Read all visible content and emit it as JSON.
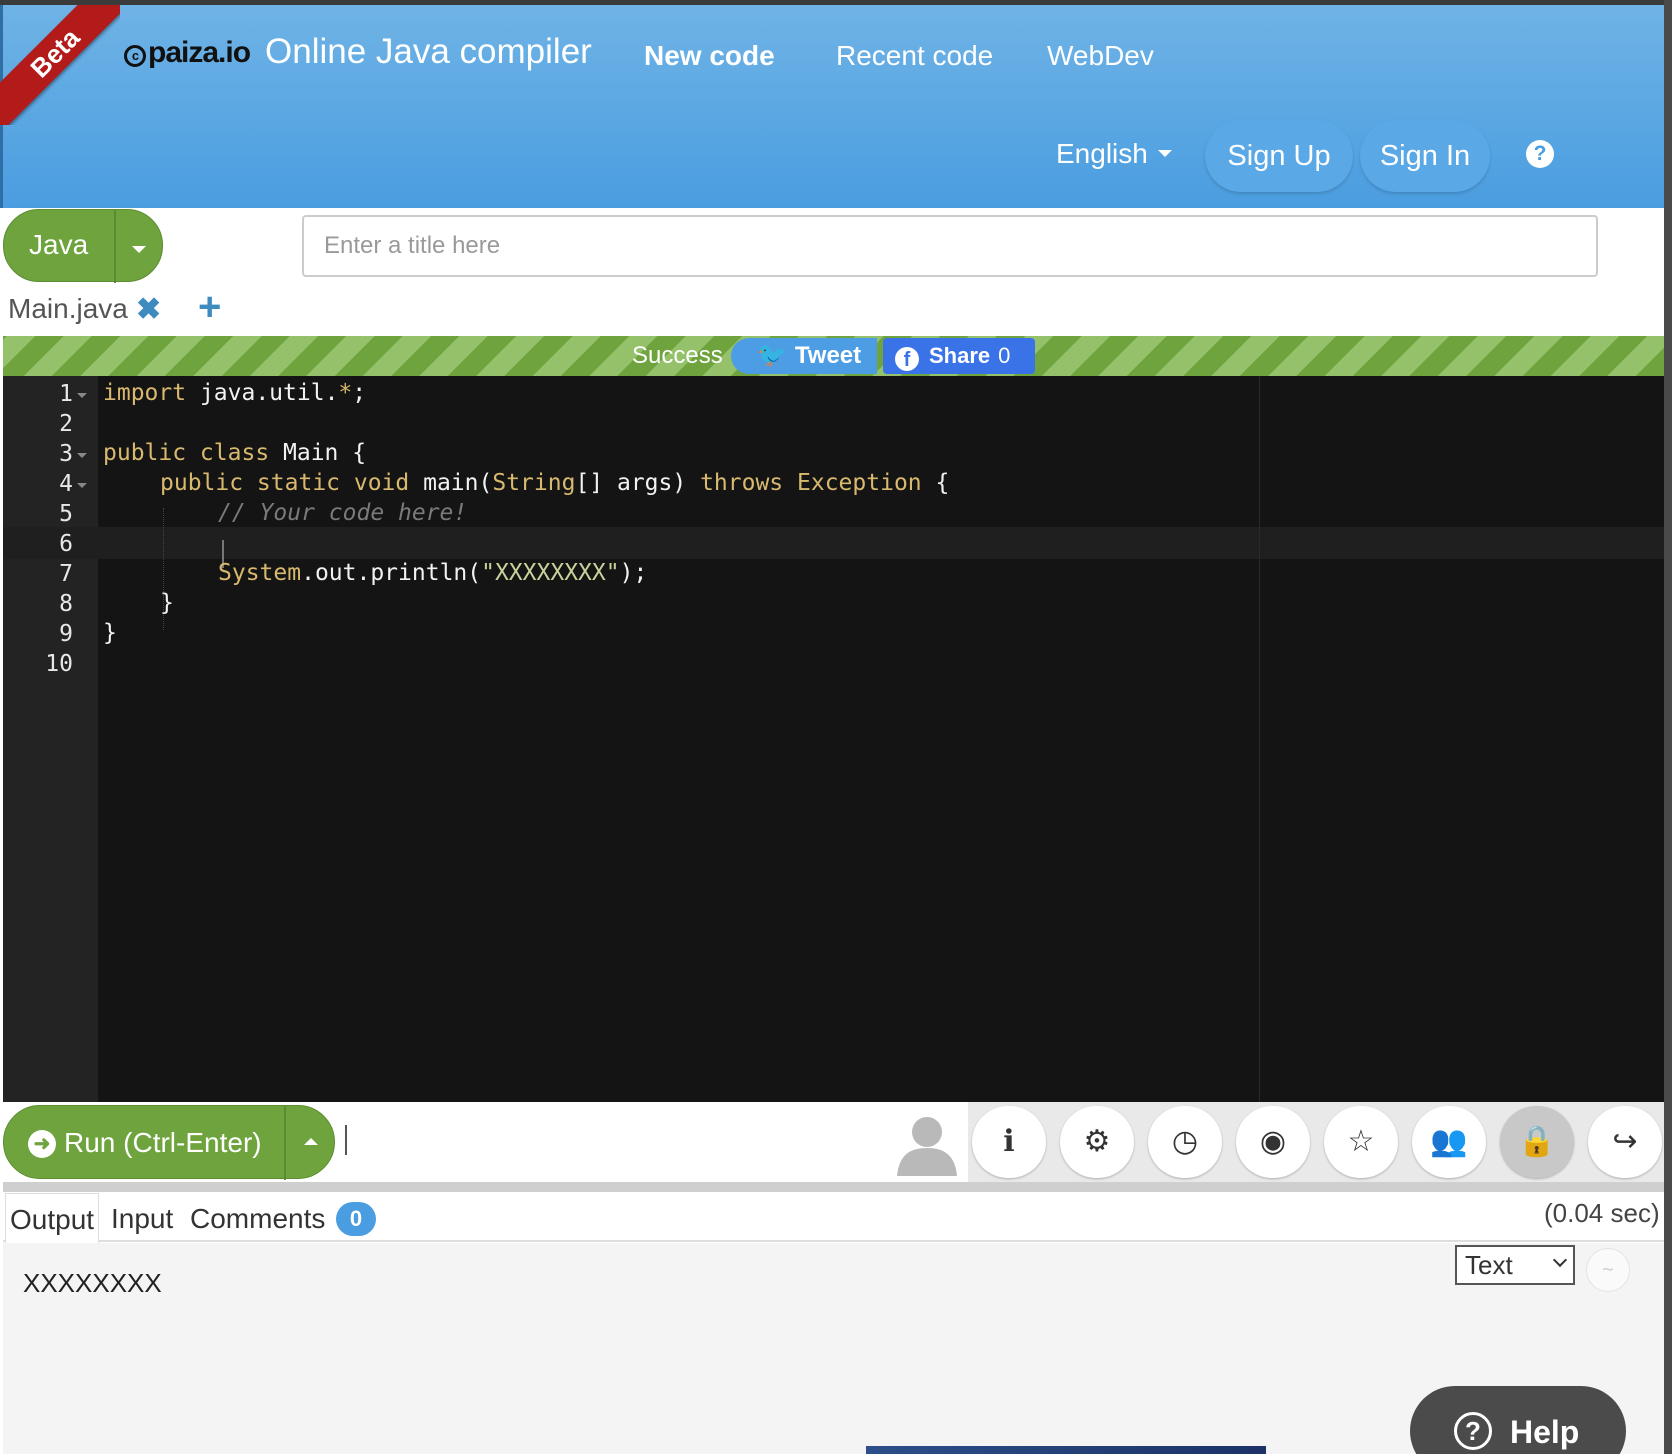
{
  "header": {
    "beta": "Beta",
    "logo": "paiza.io",
    "title": "Online Java compiler",
    "nav": [
      "New code",
      "Recent code",
      "WebDev"
    ],
    "language": "English",
    "sign_up": "Sign Up",
    "sign_in": "Sign In",
    "help_icon": "?"
  },
  "toolbar": {
    "language_button": "Java",
    "title_placeholder": "Enter a title here"
  },
  "files": {
    "active_tab": "Main.java",
    "close_icon": "✖",
    "add_icon": "+"
  },
  "status": {
    "text": "Success",
    "tweet": "Tweet",
    "share": "Share",
    "share_count": "0"
  },
  "editor": {
    "line_numbers": [
      "1",
      "2",
      "3",
      "4",
      "5",
      "6",
      "7",
      "8",
      "9",
      "10"
    ],
    "lines": [
      {
        "kw": "import",
        "rest": " java.util.",
        "op": "*",
        "end": ";"
      },
      {},
      {
        "kw": "public class",
        "rest": " Main {"
      },
      {
        "kw1": "public static void",
        "mid": " main(",
        "ty": "String",
        "mid2": "[] args) ",
        "kw2": "throws",
        "sp": " ",
        "ty2": "Exception",
        "end": " {"
      },
      {
        "comment": "// Your code here!"
      },
      {},
      {
        "ty": "System",
        "rest": ".out.println(",
        "str": "\"XXXXXXXX\"",
        "end": ");"
      },
      {
        "text": "}"
      },
      {
        "text": "}"
      },
      {}
    ]
  },
  "run": {
    "label": "Run (Ctrl-Enter)"
  },
  "tools": {
    "icons": [
      "info-icon",
      "gear-icon",
      "clock-icon",
      "github-icon",
      "star-icon",
      "group-icon",
      "lock-icon",
      "share-icon"
    ],
    "glyphs": [
      "ℹ",
      "⚙",
      "◷",
      "◉",
      "☆",
      "👥",
      "🔒",
      "↪"
    ]
  },
  "output": {
    "tabs": [
      "Output",
      "Input",
      "Comments"
    ],
    "comments_count": "0",
    "runtime": "(0.04 sec)",
    "text": "XXXXXXXX",
    "format": "Text",
    "wrap_icon": "~"
  },
  "help": {
    "label": "Help",
    "icon": "?"
  },
  "colors": {
    "header": "#4a9de0",
    "success_green": "#6ea33d",
    "editor_bg": "#141414",
    "keyword": "#d9b96e",
    "string": "#c7d39a",
    "comment": "#7a7a7a"
  }
}
